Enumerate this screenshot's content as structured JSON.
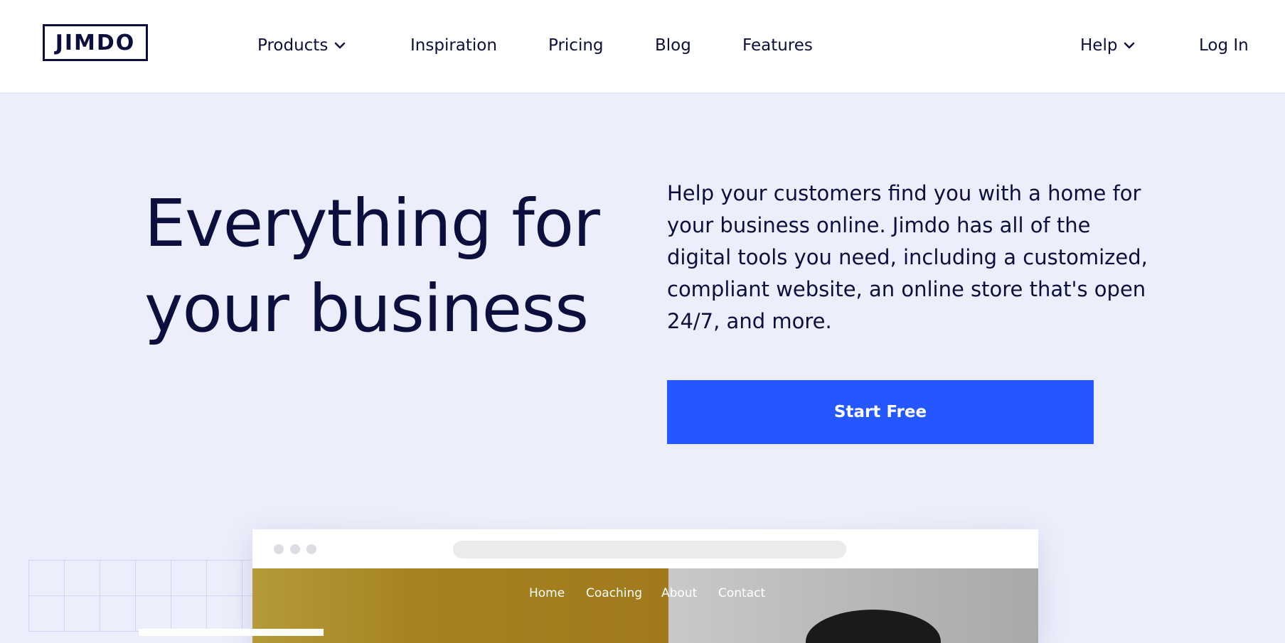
{
  "header": {
    "logo_text": "JIMDO",
    "nav": {
      "products": "Products",
      "inspiration": "Inspiration",
      "pricing": "Pricing",
      "blog": "Blog",
      "features": "Features",
      "help": "Help",
      "login": "Log In"
    }
  },
  "hero": {
    "title_line1": "Everything for",
    "title_line2": "your business",
    "description": "Help your customers find you with a home for your business online. Jimdo has all of the digital tools you need, including a customized, compliant website, an online store that's open 24/7, and more.",
    "cta_label": "Start Free"
  },
  "preview": {
    "nav": {
      "home": "Home",
      "coaching": "Coaching",
      "about": "About",
      "contact": "Contact"
    }
  },
  "colors": {
    "text_primary": "#0c0f3d",
    "hero_background": "#eceefc",
    "cta_background": "#2457ff",
    "header_background": "#ffffff"
  },
  "icons": [
    "chevron-down-icon"
  ]
}
